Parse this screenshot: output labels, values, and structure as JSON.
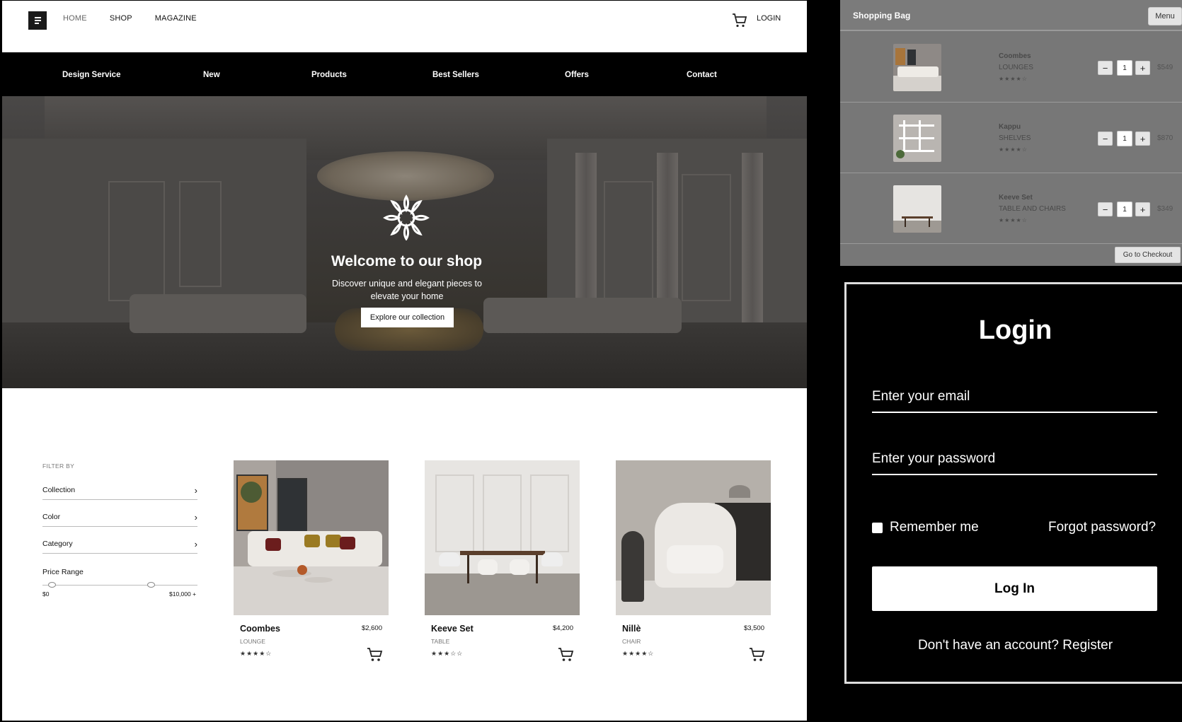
{
  "header": {
    "nav": [
      "HOME",
      "SHOP",
      "MAGAZINE"
    ],
    "login": "LOGIN"
  },
  "categories": [
    "Design Service",
    "New",
    "Products",
    "Best Sellers",
    "Offers",
    "Contact"
  ],
  "hero": {
    "title": "Welcome to our shop",
    "subtitle": "Discover unique and elegant pieces to elevate your home",
    "button": "Explore our collection"
  },
  "filters": {
    "label": "FILTER BY",
    "items": [
      "Collection",
      "Color",
      "Category"
    ],
    "price_label": "Price Range",
    "price_min": "$0",
    "price_max": "$10,000 +",
    "range_low_fraction": 0.06,
    "range_high_fraction": 0.7
  },
  "products": [
    {
      "name": "Coombes",
      "price": "$2,600",
      "category": "LOUNGE",
      "stars": "★★★★☆"
    },
    {
      "name": "Keeve Set",
      "price": "$4,200",
      "category": "TABLE",
      "stars": "★★★☆☆"
    },
    {
      "name": "Nillè",
      "price": "$3,500",
      "category": "CHAIR",
      "stars": "★★★★☆"
    }
  ],
  "bag": {
    "title": "Shopping Bag",
    "menu": "Menu",
    "items": [
      {
        "name": "Coombes",
        "category": "LOUNGES",
        "stars": "★★★★☆",
        "qty": "1",
        "price": "$549"
      },
      {
        "name": "Kappu",
        "category": "SHELVES",
        "stars": "★★★★☆",
        "qty": "1",
        "price": "$870"
      },
      {
        "name": "Keeve Set",
        "category": "TABLE AND CHAIRS",
        "stars": "★★★★☆",
        "qty": "1",
        "price": "$349"
      }
    ],
    "minus": "−",
    "plus": "+",
    "checkout": "Go to Checkout"
  },
  "login": {
    "title": "Login",
    "email_placeholder": "Enter your email",
    "password_placeholder": "Enter your password",
    "remember": "Remember me",
    "forgot": "Forgot password?",
    "button": "Log In",
    "register": "Don't have an account? Register"
  }
}
